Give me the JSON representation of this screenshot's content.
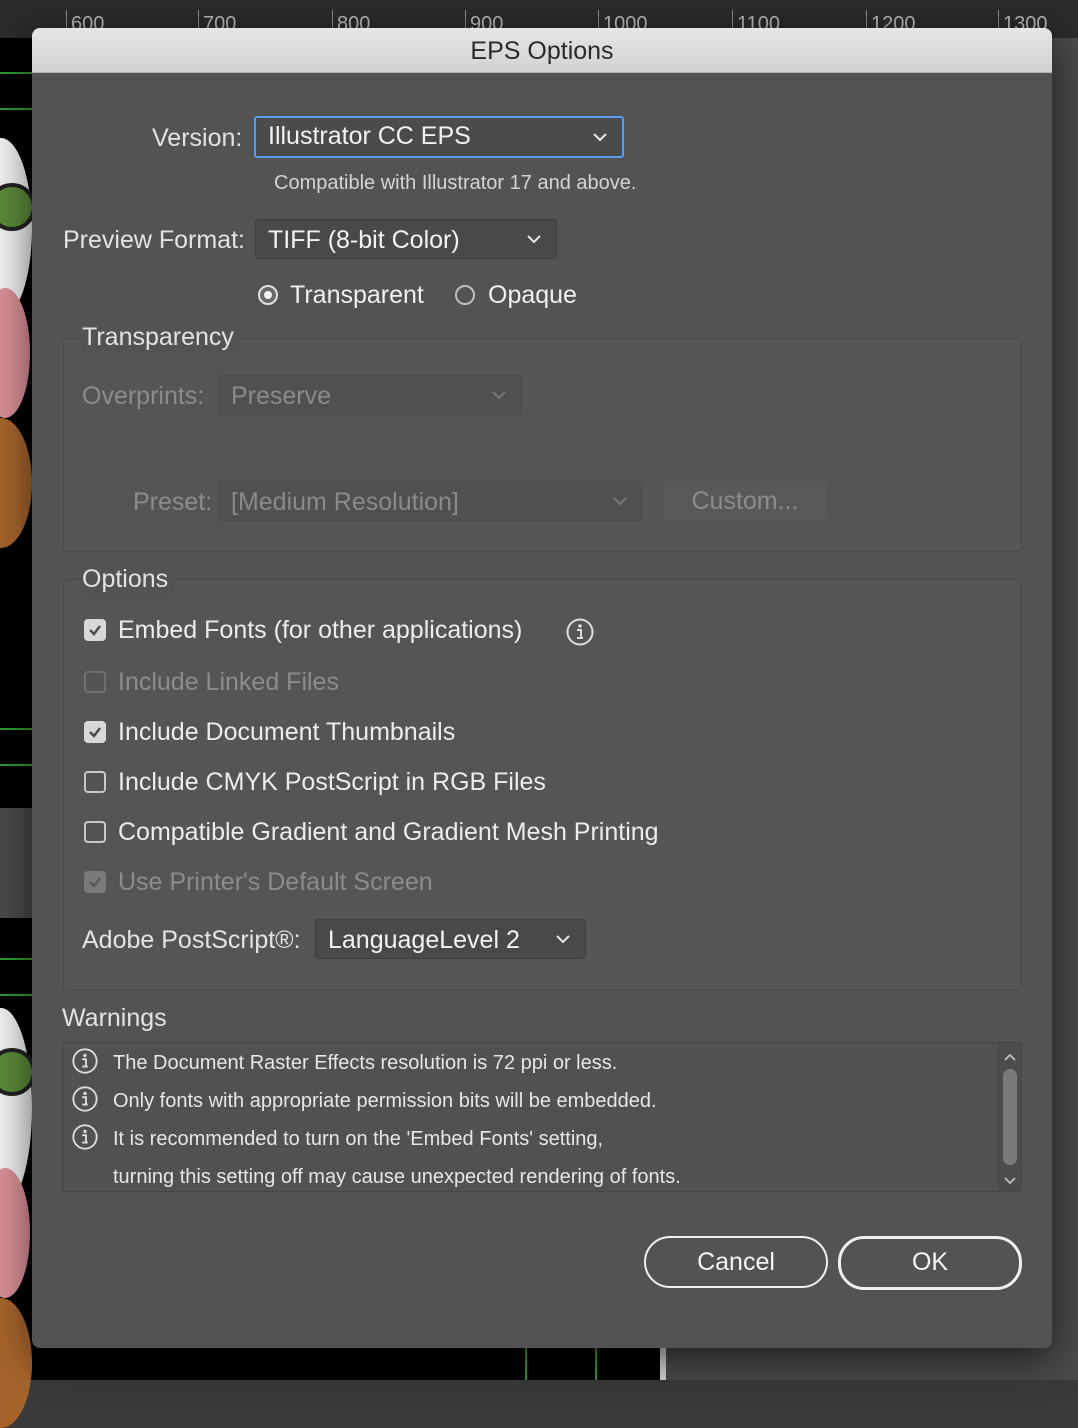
{
  "ruler": {
    "ticks": [
      "600",
      "700",
      "800",
      "900",
      "1000",
      "1100",
      "1200",
      "1300"
    ]
  },
  "dialog": {
    "title": "EPS Options",
    "version": {
      "label": "Version:",
      "value": "Illustrator CC EPS",
      "note": "Compatible with Illustrator 17 and above."
    },
    "preview": {
      "label": "Preview Format:",
      "value": "TIFF (8-bit Color)",
      "radio_transparent": "Transparent",
      "radio_opaque": "Opaque",
      "selected": "Transparent"
    },
    "transparency": {
      "title": "Transparency",
      "overprints_label": "Overprints:",
      "overprints_value": "Preserve",
      "preset_label": "Preset:",
      "preset_value": "[Medium Resolution]",
      "custom_button": "Custom..."
    },
    "options": {
      "title": "Options",
      "checkboxes": [
        {
          "label": "Embed Fonts (for other applications)",
          "checked": true,
          "enabled": true
        },
        {
          "label": "Include Linked Files",
          "checked": false,
          "enabled": false
        },
        {
          "label": "Include Document Thumbnails",
          "checked": true,
          "enabled": true
        },
        {
          "label": "Include CMYK PostScript in RGB Files",
          "checked": false,
          "enabled": true
        },
        {
          "label": "Compatible Gradient and Gradient Mesh Printing",
          "checked": false,
          "enabled": true
        },
        {
          "label": "Use Printer's Default Screen",
          "checked": true,
          "enabled": false
        }
      ],
      "postscript_label": "Adobe PostScript®:",
      "postscript_value": "LanguageLevel 2"
    },
    "warnings": {
      "title": "Warnings",
      "lines": [
        "The Document Raster Effects resolution is 72 ppi or less.",
        "Only fonts with appropriate permission bits will be embedded.",
        "It is recommended to turn on the 'Embed Fonts' setting,",
        "turning this setting off may cause unexpected rendering of fonts."
      ]
    },
    "buttons": {
      "cancel": "Cancel",
      "ok": "OK"
    }
  }
}
